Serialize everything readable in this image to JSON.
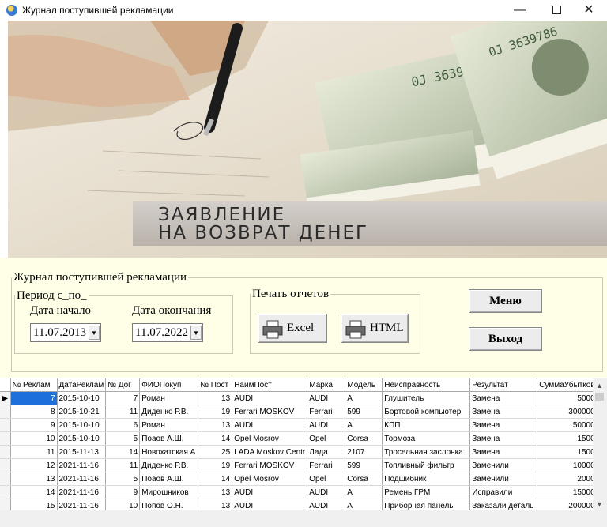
{
  "window": {
    "title": "Журнал поступившей рекламации",
    "minimize_glyph": "—",
    "close_glyph": "✕"
  },
  "banner": {
    "line1": "ЗАЯВЛЕНИЕ",
    "line2": "НА  ВОЗВРАТ  ДЕНЕГ"
  },
  "panel": {
    "group_title": "Журнал поступившей рекламации",
    "period": {
      "title": "Период с_по_",
      "start_label": "Дата начало",
      "end_label": "Дата окончания",
      "start_value": "11.07.2013",
      "end_value": "11.07.2022"
    },
    "print": {
      "title": "Печать отчетов",
      "excel_label": "Excel",
      "html_label": "HTML"
    },
    "menu_label": "Меню",
    "exit_label": "Выход"
  },
  "grid": {
    "columns": [
      "№ Реклам",
      "ДатаРеклам",
      "№ Дог",
      "ФИОПокуп",
      "№ Пост",
      "НаимПост",
      "Марка",
      "Модель",
      "Неисправность",
      "Результат",
      "СуммаУбытков"
    ],
    "rows": [
      [
        "7",
        "2015-10-10",
        "7",
        "Роман",
        "13",
        "AUDI",
        "AUDI",
        "A",
        "Глушитель",
        "Замена",
        "5000"
      ],
      [
        "8",
        "2015-10-21",
        "11",
        "Диденко Р.В.",
        "19",
        "Ferrari MOSKOV",
        "Ferrari",
        "599",
        "Бортовой компьютер",
        "Замена",
        "300000"
      ],
      [
        "9",
        "2015-10-10",
        "6",
        "Роман",
        "13",
        "AUDI",
        "AUDI",
        "A",
        "КПП",
        "Замена",
        "50000"
      ],
      [
        "10",
        "2015-10-10",
        "5",
        "Поаов А.Ш.",
        "14",
        "Opel Mosrov",
        "Opel",
        "Corsa",
        "Тормоза",
        "Замена",
        "1500"
      ],
      [
        "11",
        "2015-11-13",
        "14",
        "Новохатская А",
        "25",
        "LADA Moskov Centr",
        "Лада",
        "2107",
        "Тросельная заслонка",
        "Замена",
        "1500"
      ],
      [
        "12",
        "2021-11-16",
        "11",
        "Диденко Р.В.",
        "19",
        "Ferrari MOSKOV",
        "Ferrari",
        "599",
        "Топливный фильтр",
        "Заменили",
        "10000"
      ],
      [
        "13",
        "2021-11-16",
        "5",
        "Поаов А.Ш.",
        "14",
        "Opel Mosrov",
        "Opel",
        "Corsa",
        "Подшибник",
        "Заменили",
        "2000"
      ],
      [
        "14",
        "2021-11-16",
        "9",
        "Мирошников",
        "13",
        "AUDI",
        "AUDI",
        "A",
        "Ремень ГРМ",
        "Исправили",
        "15000"
      ],
      [
        "15",
        "2021-11-16",
        "10",
        "Попов О.Н.",
        "13",
        "AUDI",
        "AUDI",
        "A",
        "Приборная панель",
        "Заказали деталь",
        "200000"
      ]
    ],
    "selected_row": 0
  },
  "colors": {
    "panel_background": "#ffffe8",
    "selection": "#1e6fd9",
    "banner_plate": "#c8c2bc"
  }
}
